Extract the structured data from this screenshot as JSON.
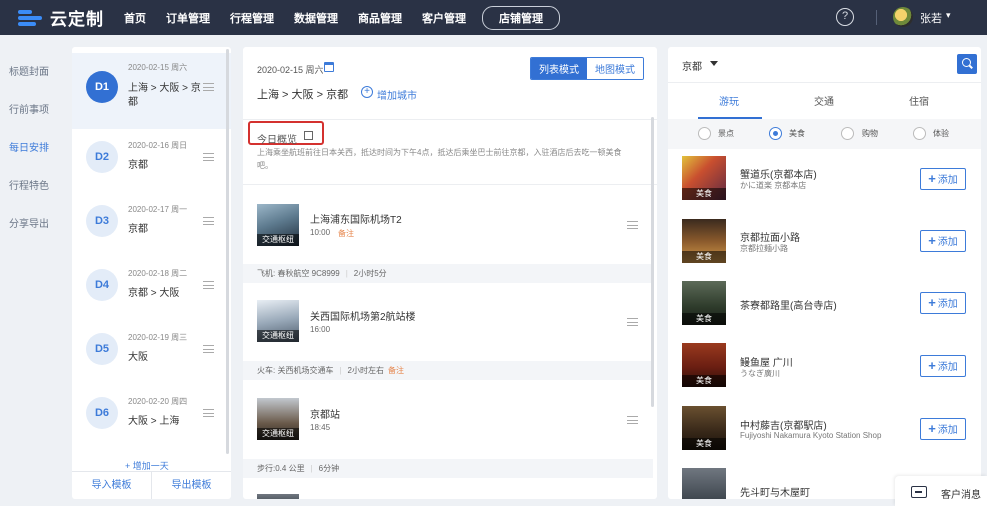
{
  "header": {
    "logo_text": "云定制",
    "nav": [
      "首页",
      "订单管理",
      "行程管理",
      "数据管理",
      "商品管理",
      "客户管理",
      "店铺管理"
    ],
    "help": "?",
    "user": "张若"
  },
  "left_menu": [
    "标题封面",
    "行前事项",
    "每日安排",
    "行程特色",
    "分享导出"
  ],
  "days": [
    {
      "badge": "D1",
      "date": "2020-02-15 周六",
      "route": "上海 > 大阪 > 京都"
    },
    {
      "badge": "D2",
      "date": "2020-02-16 周日",
      "route": "京都"
    },
    {
      "badge": "D3",
      "date": "2020-02-17 周一",
      "route": "京都"
    },
    {
      "badge": "D4",
      "date": "2020-02-18 周二",
      "route": "京都 > 大阪"
    },
    {
      "badge": "D5",
      "date": "2020-02-19 周三",
      "route": "大阪"
    },
    {
      "badge": "D6",
      "date": "2020-02-20 周四",
      "route": "大阪 > 上海"
    }
  ],
  "days_panel": {
    "add_day": "+ 增加一天",
    "import": "导入模板",
    "export": "导出模板"
  },
  "middle": {
    "date": "2020-02-15 周六",
    "route": "上海 > 大阪 > 京都",
    "add_city": "增加城市",
    "mode_list": "列表模式",
    "mode_map": "地图模式",
    "overview_label": "今日概览",
    "overview_text": "上海乘坐航班前往日本关西，抵达时间为下午4点，抵达后乘坐巴士前往京都，入驻酒店后去吃一顿美食吧。",
    "entries": [
      {
        "title": "上海浦东国际机场T2",
        "time": "10:00",
        "note": "备注",
        "tag": "交通枢纽"
      },
      {
        "title": "关西国际机场第2航站楼",
        "time": "16:00",
        "note": "",
        "tag": "交通枢纽"
      },
      {
        "title": "京都站",
        "time": "18:45",
        "note": "",
        "tag": "交通枢纽"
      }
    ],
    "transports": [
      {
        "info": "飞机: 春秋航空 9C8999",
        "duration": "2小时5分",
        "note": ""
      },
      {
        "info": "火车: 关西机场交通车",
        "duration": "2小时左右",
        "note": "备注"
      },
      {
        "info": "步行:0.4 公里",
        "duration": "6分钟",
        "note": ""
      }
    ]
  },
  "right": {
    "city": "京都",
    "tabs": [
      "游玩",
      "交通",
      "住宿"
    ],
    "filters": [
      "景点",
      "美食",
      "购物",
      "体验"
    ],
    "add_label": "添加",
    "pois": [
      {
        "name": "蟹道乐(京都本店)",
        "sub": "かに道楽 京都本店",
        "tag": "美食"
      },
      {
        "name": "京都拉面小路",
        "sub": "京都拉麺小路",
        "tag": "美食"
      },
      {
        "name": "茶寮都路里(高台寺店)",
        "sub": "",
        "tag": "美食"
      },
      {
        "name": "鳗鱼屋 广川",
        "sub": "うなぎ廣川",
        "tag": "美食"
      },
      {
        "name": "中村藤吉(京都駅店)",
        "sub": "Fujiyoshi Nakamura Kyoto Station Shop",
        "tag": "美食"
      },
      {
        "name": "先斗町与木屋町",
        "sub": "",
        "tag": ""
      }
    ]
  },
  "chat": {
    "label": "客户消息"
  }
}
